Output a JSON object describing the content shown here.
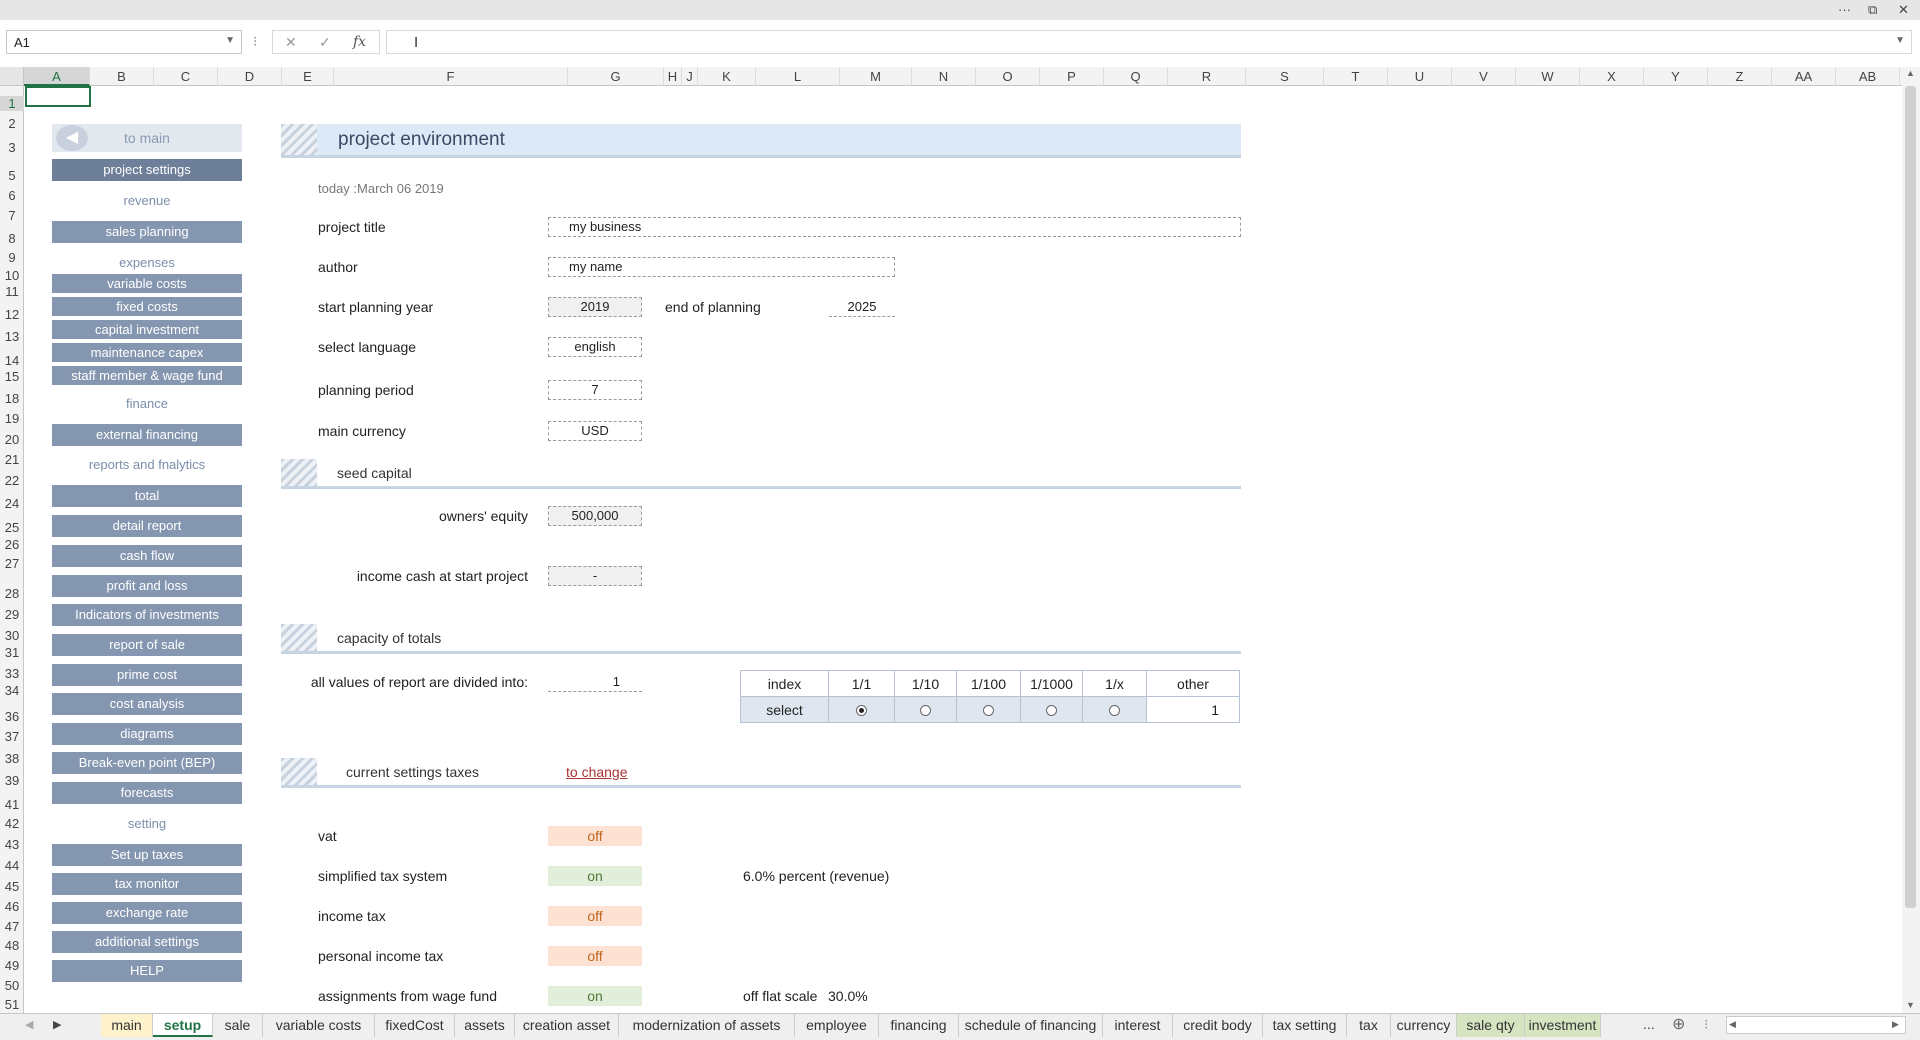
{
  "formula_bar": {
    "name_box": "A1",
    "formula": "",
    "fx": "fx"
  },
  "columns": [
    "A",
    "B",
    "C",
    "D",
    "E",
    "F",
    "G",
    "H",
    "J",
    "K",
    "L",
    "M",
    "N",
    "O",
    "P",
    "Q",
    "R",
    "S",
    "T",
    "U",
    "V",
    "W",
    "X",
    "Y",
    "Z",
    "AA",
    "AB"
  ],
  "rows": [
    "1",
    "2",
    "3",
    "5",
    "6",
    "7",
    "8",
    "9",
    "10",
    "11",
    "12",
    "13",
    "14",
    "15",
    "18",
    "19",
    "20",
    "21",
    "22",
    "24",
    "25",
    "26",
    "27",
    "28",
    "29",
    "30",
    "31",
    "33",
    "34",
    "36",
    "37",
    "38",
    "39",
    "41",
    "42",
    "43",
    "44",
    "45",
    "46",
    "47",
    "48",
    "49",
    "50",
    "51"
  ],
  "nav": {
    "to_main": "to main",
    "project_settings": "project settings",
    "revenue": "revenue",
    "sales_planning": "sales planning",
    "expenses": "expenses",
    "variable_costs": "variable costs",
    "fixed_costs": "fixed costs",
    "capital_investment": "capital investment",
    "maintenance_capex": "maintenance capex",
    "staff": "staff member & wage fund",
    "finance": "finance",
    "external_financing": "external financing",
    "reports": "reports and fnalytics",
    "total": "total",
    "detail_report": "detail report",
    "cash_flow": "cash flow",
    "profit_and_loss": "profit and loss",
    "indicators": "Indicators of investments",
    "report_of_sale": "report of sale",
    "prime_cost": "prime cost",
    "cost_analysis": "cost analysis",
    "diagrams": "diagrams",
    "bep": "Break-even point (BEP)",
    "forecasts": "forecasts",
    "setting": "setting",
    "set_up_taxes": "Set up taxes",
    "tax_monitor": "tax monitor",
    "exchange_rate": "exchange rate",
    "additional_settings": "additional settings",
    "help": "HELP"
  },
  "env": {
    "title": "project environment",
    "today": "today :March 06 2019",
    "project_title_label": "project title",
    "project_title": "my business",
    "author_label": "author",
    "author": "my name",
    "start_year_label": "start planning year",
    "start_year": "2019",
    "end_label": "end of planning",
    "end_year": "2025",
    "language_label": "select language",
    "language": "english",
    "period_label": "planning period",
    "period": "7",
    "currency_label": "main currency",
    "currency": "USD"
  },
  "seed": {
    "title": "seed capital",
    "equity_label": "owners' equity",
    "equity": "500,000",
    "income_label": "income cash at start project",
    "income": "-"
  },
  "capacity": {
    "title": "capacity of totals",
    "divided_label": "all values of report are divided into:",
    "divided_value": "1",
    "headers": [
      "index",
      "1/1",
      "1/10",
      "1/100",
      "1/1000",
      "1/x",
      "other"
    ],
    "select_label": "select",
    "selected_index": 0,
    "other_value": "1"
  },
  "taxes": {
    "title": "current settings taxes",
    "change_link": "to change",
    "vat_label": "vat",
    "vat": "off",
    "simplified_label": "simplified tax system",
    "simplified": "on",
    "simplified_note": "6.0% percent (revenue)",
    "income_label": "income tax",
    "income": "off",
    "personal_label": "personal income tax",
    "personal": "off",
    "wage_label": "assignments from wage fund",
    "wage": "on",
    "wage_note": "off flat scale",
    "wage_note_val": "30.0%"
  },
  "tabs": [
    "main",
    "setup",
    "sale",
    "variable costs",
    "fixedCost",
    "assets",
    "creation asset",
    "modernization of assets",
    "employee",
    "financing",
    "schedule of financing",
    "interest",
    "credit body",
    "tax setting",
    "tax",
    "currency",
    "sale qty",
    "investment"
  ],
  "active_tab": "setup",
  "tab_more": "..."
}
